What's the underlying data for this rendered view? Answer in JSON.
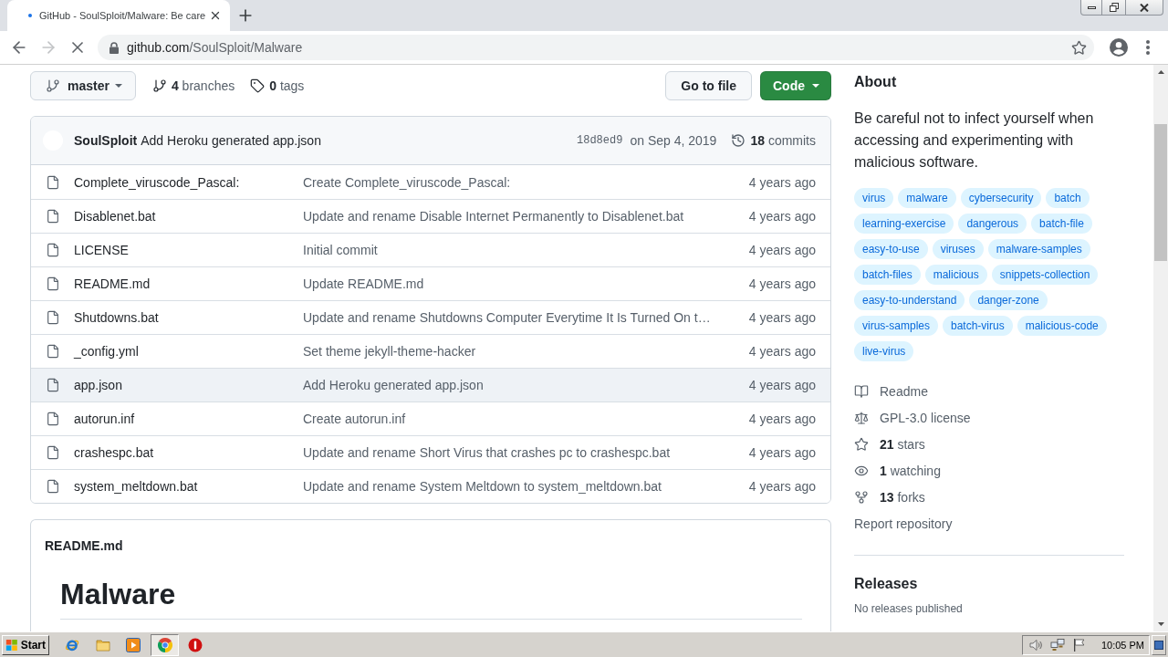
{
  "browser": {
    "tab": {
      "title": "GitHub - SoulSploit/Malware: Be care",
      "loading": true
    },
    "address": {
      "host": "github.com",
      "path": "/SoulSploit/Malware"
    }
  },
  "repo_bar": {
    "branch": "master",
    "branches": {
      "count": "4",
      "label": "branches"
    },
    "tags": {
      "count": "0",
      "label": "tags"
    },
    "buttons": [
      {
        "label": "Go to file",
        "kind": "secondary"
      },
      {
        "label": "Code",
        "kind": "primary"
      }
    ]
  },
  "latest_commit": {
    "author": "SoulSploit",
    "message": "Add Heroku generated app.json",
    "sha": "18d8ed9",
    "date": "on Sep 4, 2019",
    "commits": {
      "count": "18",
      "label": "commits"
    }
  },
  "files": [
    {
      "name": "Complete_viruscode_Pascal:",
      "message": "Create Complete_viruscode_Pascal:",
      "time": "4 years ago",
      "hovered": false
    },
    {
      "name": "Disablenet.bat",
      "message": "Update and rename Disable Internet Permanently to Disablenet.bat",
      "time": "4 years ago",
      "hovered": false
    },
    {
      "name": "LICENSE",
      "message": "Initial commit",
      "time": "4 years ago",
      "hovered": false
    },
    {
      "name": "README.md",
      "message": "Update README.md",
      "time": "4 years ago",
      "hovered": false
    },
    {
      "name": "Shutdowns.bat",
      "message": "Update and rename Shutdowns Computer Everytime It Is Turned On t…",
      "time": "4 years ago",
      "hovered": false
    },
    {
      "name": "_config.yml",
      "message": "Set theme jekyll-theme-hacker",
      "time": "4 years ago",
      "hovered": false
    },
    {
      "name": "app.json",
      "message": "Add Heroku generated app.json",
      "time": "4 years ago",
      "hovered": true
    },
    {
      "name": "autorun.inf",
      "message": "Create autorun.inf",
      "time": "4 years ago",
      "hovered": false
    },
    {
      "name": "crashespc.bat",
      "message": "Update and rename Short Virus that crashes pc to crashespc.bat",
      "time": "4 years ago",
      "hovered": false
    },
    {
      "name": "system_meltdown.bat",
      "message": "Update and rename System Meltdown to system_meltdown.bat",
      "time": "4 years ago",
      "hovered": false
    }
  ],
  "readme": {
    "filename": "README.md",
    "heading": "Malware"
  },
  "about": {
    "title": "About",
    "description": "Be careful not to infect yourself when accessing and experimenting with malicious software.",
    "topics": [
      "virus",
      "malware",
      "cybersecurity",
      "batch",
      "learning-exercise",
      "dangerous",
      "batch-file",
      "easy-to-use",
      "viruses",
      "malware-samples",
      "batch-files",
      "malicious",
      "snippets-collection",
      "easy-to-understand",
      "danger-zone",
      "virus-samples",
      "batch-virus",
      "malicious-code",
      "live-virus"
    ],
    "meta": [
      {
        "kind": "readme",
        "label": "Readme"
      },
      {
        "kind": "license",
        "label": "GPL-3.0 license"
      },
      {
        "kind": "stars",
        "count": "21",
        "label": "stars"
      },
      {
        "kind": "watching",
        "count": "1",
        "label": "watching"
      },
      {
        "kind": "forks",
        "count": "13",
        "label": "forks"
      }
    ],
    "report": "Report repository"
  },
  "releases": {
    "title": "Releases",
    "note": "No releases published"
  },
  "taskbar": {
    "start": "Start",
    "clock": "10:05 PM"
  }
}
